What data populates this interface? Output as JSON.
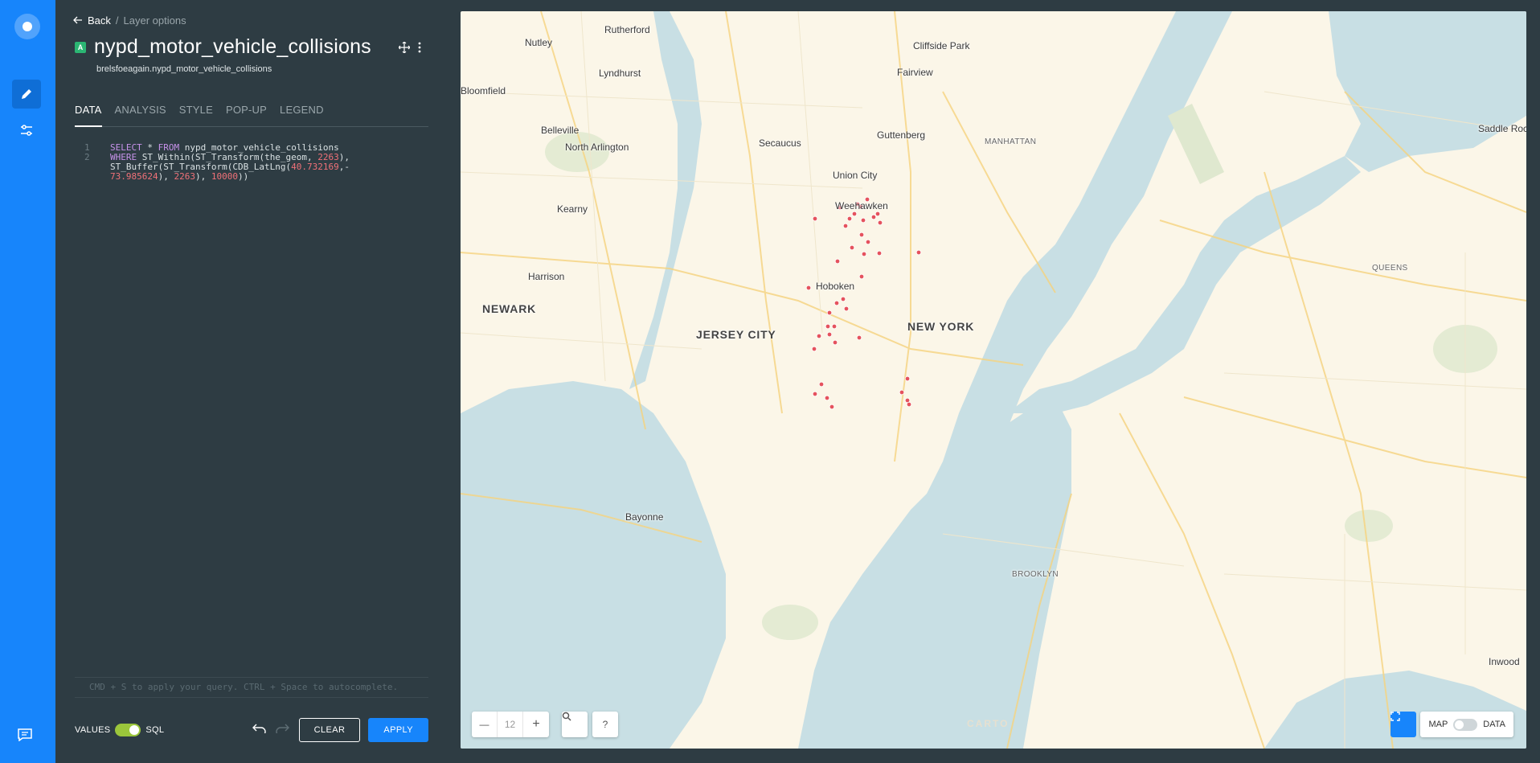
{
  "nav": {
    "logo_icon": "carto-logo-icon",
    "items": [
      {
        "name": "edit",
        "icon": "pencil-icon",
        "active": true
      },
      {
        "name": "settings",
        "icon": "sliders-icon",
        "active": false
      }
    ],
    "chat_icon": "chat-icon"
  },
  "breadcrumb": {
    "back_label": "Back",
    "separator": "/",
    "current": "Layer options"
  },
  "layer": {
    "badge": "A",
    "title": "nypd_motor_vehicle_collisions",
    "subtitle": "brelsfoeagain.nypd_motor_vehicle_collisions"
  },
  "tabs": [
    {
      "label": "DATA",
      "active": true
    },
    {
      "label": "ANALYSIS",
      "active": false
    },
    {
      "label": "STYLE",
      "active": false
    },
    {
      "label": "POP-UP",
      "active": false
    },
    {
      "label": "LEGEND",
      "active": false
    }
  ],
  "editor": {
    "line_numbers": [
      "1",
      "2"
    ],
    "hint": "CMD + S to apply your query. CTRL + Space to autocomplete."
  },
  "footer": {
    "values_label": "VALUES",
    "sql_label": "SQL",
    "clear_label": "CLEAR",
    "apply_label": "APPLY"
  },
  "map": {
    "zoom_level": "12",
    "zoom_out": "—",
    "zoom_in": "+",
    "search_icon": "search-icon",
    "help_label": "?",
    "map_label": "MAP",
    "data_label": "DATA",
    "attribution": "CARTO",
    "places": [
      {
        "name": "Rutherford",
        "cls": ""
      },
      {
        "name": "Nutley",
        "cls": ""
      },
      {
        "name": "Cliffside Park",
        "cls": ""
      },
      {
        "name": "Lyndhurst",
        "cls": ""
      },
      {
        "name": "Fairview",
        "cls": ""
      },
      {
        "name": "Bloomfield",
        "cls": ""
      },
      {
        "name": "Belleville",
        "cls": ""
      },
      {
        "name": "North Arlington",
        "cls": ""
      },
      {
        "name": "Secaucus",
        "cls": ""
      },
      {
        "name": "Guttenberg",
        "cls": ""
      },
      {
        "name": "MANHATTAN",
        "cls": "small"
      },
      {
        "name": "Union City",
        "cls": ""
      },
      {
        "name": "Weehawken",
        "cls": ""
      },
      {
        "name": "Kearny",
        "cls": ""
      },
      {
        "name": "Harrison",
        "cls": ""
      },
      {
        "name": "Hoboken",
        "cls": ""
      },
      {
        "name": "NEWARK",
        "cls": "big"
      },
      {
        "name": "JERSEY CITY",
        "cls": "big"
      },
      {
        "name": "NEW YORK",
        "cls": "big"
      },
      {
        "name": "QUEENS",
        "cls": "small"
      },
      {
        "name": "Saddle Rock",
        "cls": ""
      },
      {
        "name": "Bayonne",
        "cls": ""
      },
      {
        "name": "BROOKLYN",
        "cls": "small"
      },
      {
        "name": "Inwood",
        "cls": ""
      }
    ],
    "point_color": "#e5525d",
    "water_color": "#c8dfe4",
    "land_color": "#fbf6e8"
  }
}
